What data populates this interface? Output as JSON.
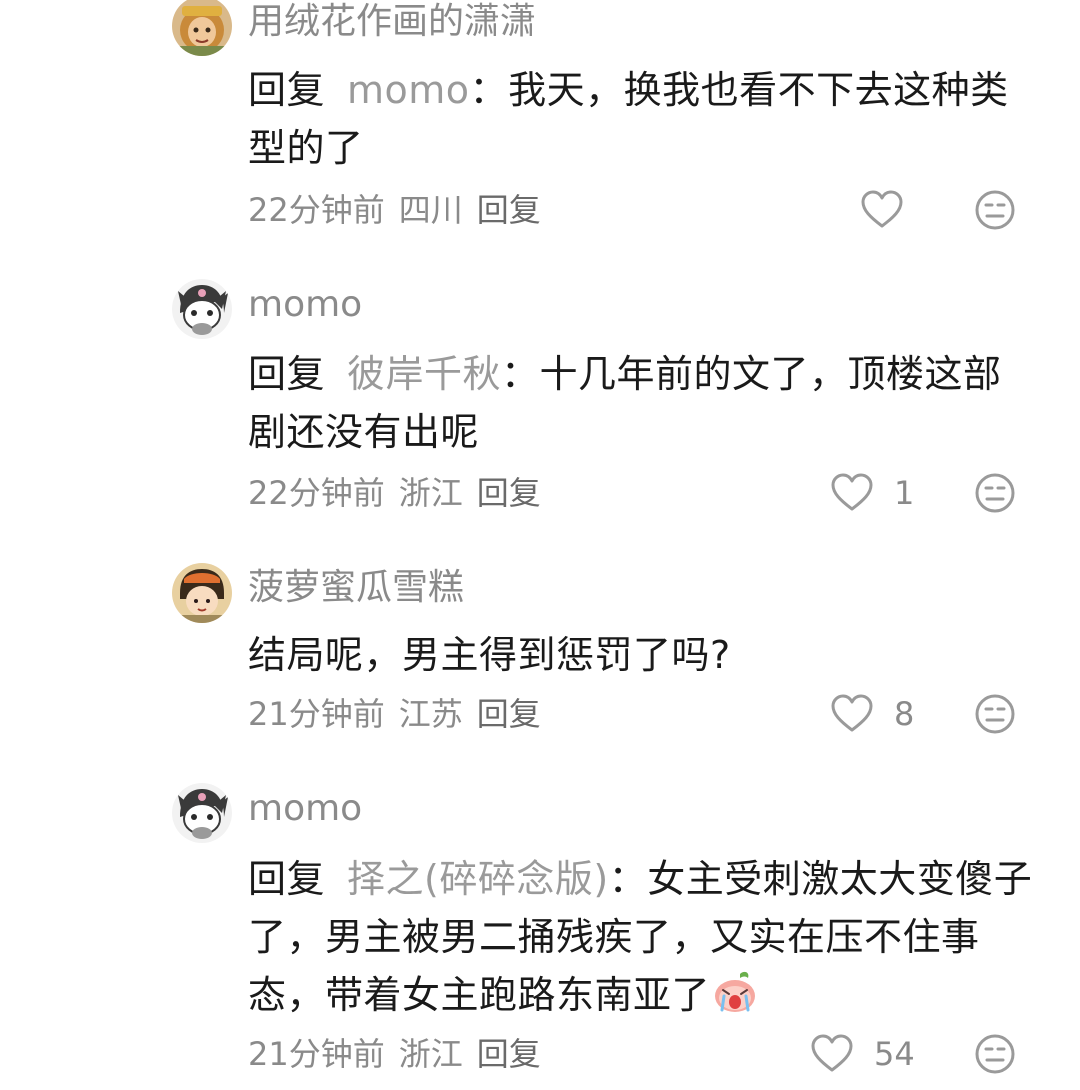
{
  "comments": [
    {
      "username": "用绒花作画的潇潇",
      "reply_prefix": "回复",
      "reply_target": "momo",
      "separator": "：",
      "text": "我天，换我也看不下去这种类型的了",
      "time": "22分钟前",
      "location": "四川",
      "reply_label": "回复",
      "like_count": "",
      "avatar_icon": "monkey-king-avatar"
    },
    {
      "username": "momo",
      "reply_prefix": "回复",
      "reply_target": "彼岸千秋",
      "separator": "：",
      "text": "十几年前的文了，顶楼这部剧还没有出呢",
      "time": "22分钟前",
      "location": "浙江",
      "reply_label": "回复",
      "like_count": "1",
      "avatar_icon": "kuromi-avatar"
    },
    {
      "username": "菠萝蜜瓜雪糕",
      "reply_prefix": "",
      "reply_target": "",
      "separator": "",
      "text": "结局呢，男主得到惩罚了吗?",
      "time": "21分钟前",
      "location": "江苏",
      "reply_label": "回复",
      "like_count": "8",
      "avatar_icon": "maruko-avatar"
    },
    {
      "username": "momo",
      "reply_prefix": "回复",
      "reply_target": "择之(碎碎念版)",
      "separator": "：",
      "text": "女主受刺激太大变傻子了，男主被男二捅残疾了，又实在压不住事态，带着女主跑路东南亚了",
      "time": "21分钟前",
      "location": "浙江",
      "reply_label": "回复",
      "like_count": "54",
      "avatar_icon": "kuromi-avatar",
      "trailing_emoji": "crying-peach-emoji"
    }
  ],
  "icons": {
    "like": "heart-outline-icon",
    "dislike": "neutral-face-icon"
  },
  "colors": {
    "text": "#1a1a1a",
    "muted": "#8a8a8a",
    "icon": "#9a9a9a"
  }
}
